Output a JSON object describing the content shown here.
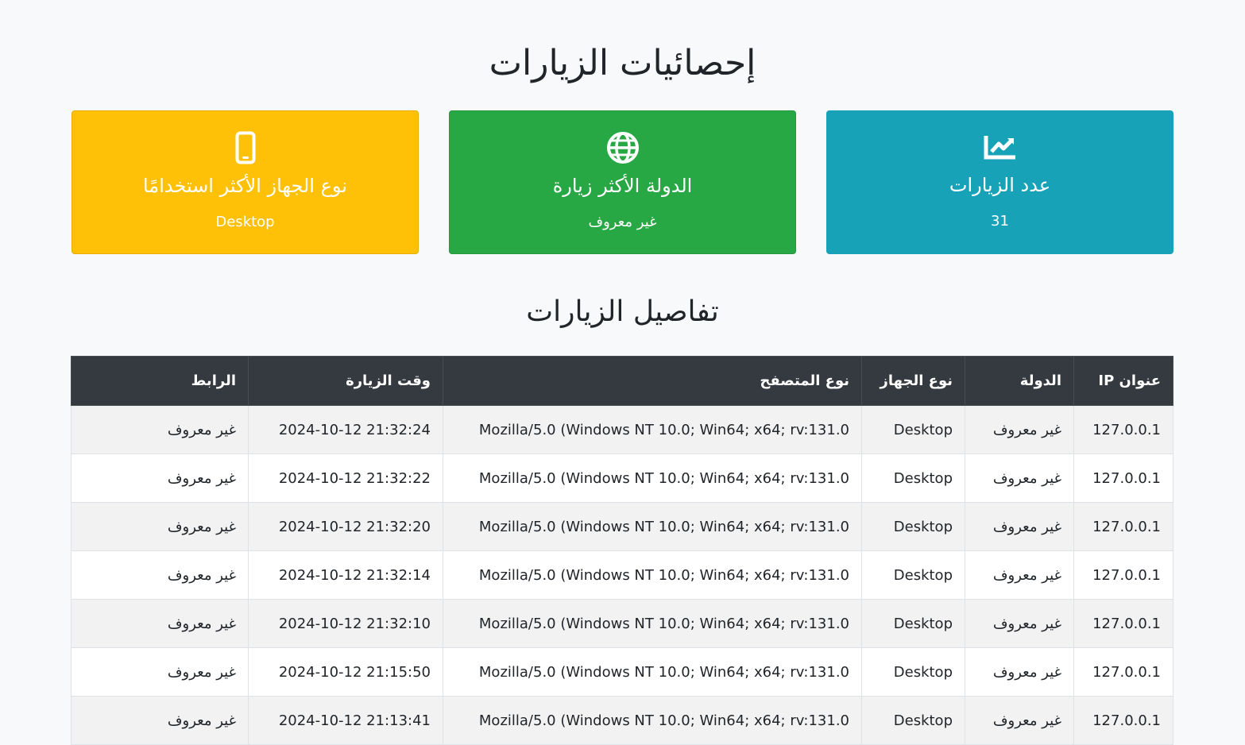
{
  "page": {
    "title": "إحصائيات الزيارات"
  },
  "cards": [
    {
      "key": "visits_count",
      "title": "عدد الزيارات",
      "value": "31",
      "icon": "chart-line-icon",
      "color": "#17a2b8"
    },
    {
      "key": "top_country",
      "title": "الدولة الأكثر زيارة",
      "value": "غير معروف",
      "icon": "globe-icon",
      "color": "#28a745"
    },
    {
      "key": "top_device",
      "title": "نوع الجهاز الأكثر استخدامًا",
      "value": "Desktop",
      "icon": "mobile-icon",
      "color": "#ffc107"
    }
  ],
  "details": {
    "title": "تفاصيل الزيارات",
    "columns": [
      "عنوان IP",
      "الدولة",
      "نوع الجهاز",
      "نوع المتصفح",
      "وقت الزيارة",
      "الرابط"
    ],
    "rows": [
      [
        "127.0.0.1",
        "غير معروف",
        "Desktop",
        "Mozilla/5.0 (Windows NT 10.0; Win64; x64; rv:131.0",
        "2024-10-12 21:32:24",
        "غير معروف"
      ],
      [
        "127.0.0.1",
        "غير معروف",
        "Desktop",
        "Mozilla/5.0 (Windows NT 10.0; Win64; x64; rv:131.0",
        "2024-10-12 21:32:22",
        "غير معروف"
      ],
      [
        "127.0.0.1",
        "غير معروف",
        "Desktop",
        "Mozilla/5.0 (Windows NT 10.0; Win64; x64; rv:131.0",
        "2024-10-12 21:32:20",
        "غير معروف"
      ],
      [
        "127.0.0.1",
        "غير معروف",
        "Desktop",
        "Mozilla/5.0 (Windows NT 10.0; Win64; x64; rv:131.0",
        "2024-10-12 21:32:14",
        "غير معروف"
      ],
      [
        "127.0.0.1",
        "غير معروف",
        "Desktop",
        "Mozilla/5.0 (Windows NT 10.0; Win64; x64; rv:131.0",
        "2024-10-12 21:32:10",
        "غير معروف"
      ],
      [
        "127.0.0.1",
        "غير معروف",
        "Desktop",
        "Mozilla/5.0 (Windows NT 10.0; Win64; x64; rv:131.0",
        "2024-10-12 21:15:50",
        "غير معروف"
      ],
      [
        "127.0.0.1",
        "غير معروف",
        "Desktop",
        "Mozilla/5.0 (Windows NT 10.0; Win64; x64; rv:131.0",
        "2024-10-12 21:13:41",
        "غير معروف"
      ]
    ]
  },
  "colors": {
    "background": "#f8f9fa",
    "table_header": "#343a40",
    "striped_row": "#f2f2f2"
  }
}
